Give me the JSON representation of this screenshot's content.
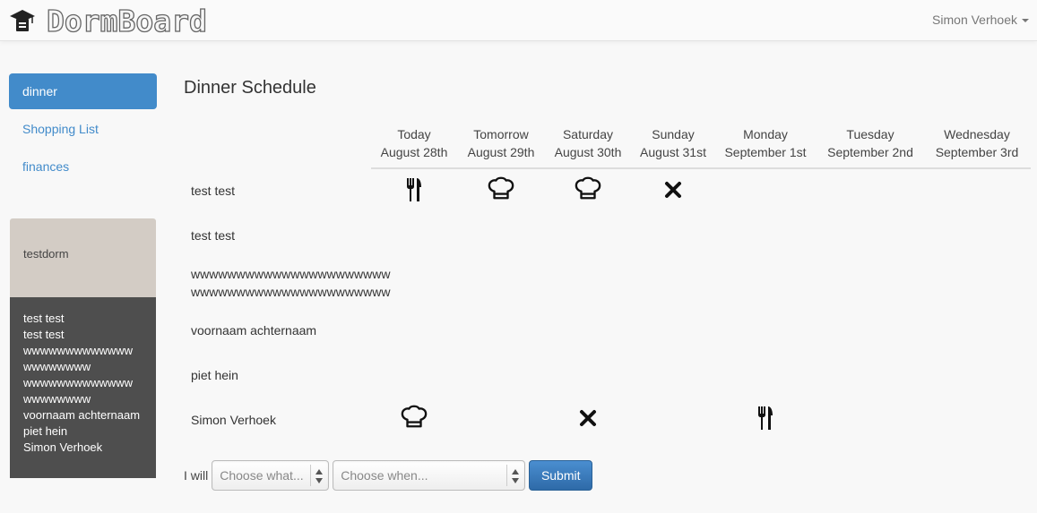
{
  "app": {
    "brand": "DormBoard",
    "user_name": "Simon Verhoek"
  },
  "sidebar": {
    "items": [
      {
        "label": "dinner",
        "active": true
      },
      {
        "label": "Shopping List",
        "active": false
      },
      {
        "label": "finances",
        "active": false
      }
    ]
  },
  "dorm": {
    "name": "testdorm",
    "members": [
      "test test",
      "test test",
      "wwwwwwwwwwwww",
      "wwwwwwww",
      "wwwwwwwwwwwww",
      "wwwwwwww",
      "voornaam achternaam",
      "piet hein",
      "Simon Verhoek"
    ]
  },
  "schedule": {
    "title": "Dinner Schedule",
    "days": [
      {
        "name": "Today",
        "date": "August 28th"
      },
      {
        "name": "Tomorrow",
        "date": "August 29th"
      },
      {
        "name": "Saturday",
        "date": "August 30th"
      },
      {
        "name": "Sunday",
        "date": "August 31st"
      },
      {
        "name": "Monday",
        "date": "September 1st"
      },
      {
        "name": "Tuesday",
        "date": "September 2nd"
      },
      {
        "name": "Wednesday",
        "date": "September 3rd"
      }
    ],
    "rows": [
      {
        "name": "test test",
        "cells": [
          "eat-icon",
          "chef-icon",
          "chef-icon",
          "absent-icon",
          "",
          "",
          ""
        ]
      },
      {
        "name": "test test",
        "cells": [
          "",
          "",
          "",
          "",
          "",
          "",
          ""
        ]
      },
      {
        "name_line1": "wwwwwwwwwwwwwwwwwwwwww",
        "name_line2": "wwwwwwwwwwwwwwwwwwwwww",
        "cells": [
          "",
          "",
          "",
          "",
          "",
          "",
          ""
        ]
      },
      {
        "name": "voornaam achternaam",
        "cells": [
          "",
          "",
          "",
          "",
          "",
          "",
          ""
        ]
      },
      {
        "name": "piet hein",
        "cells": [
          "",
          "",
          "",
          "",
          "",
          "",
          ""
        ]
      },
      {
        "name": "Simon Verhoek",
        "cells": [
          "chef-icon",
          "",
          "absent-icon",
          "",
          "eat-icon",
          "",
          ""
        ]
      }
    ]
  },
  "form": {
    "label": "I will",
    "what_placeholder": "Choose what...",
    "when_placeholder": "Choose when...",
    "submit_label": "Submit"
  },
  "colors": {
    "accent": "#428bca",
    "dorm_header": "#d3ccc5",
    "dorm_body": "#4e4e4e"
  }
}
